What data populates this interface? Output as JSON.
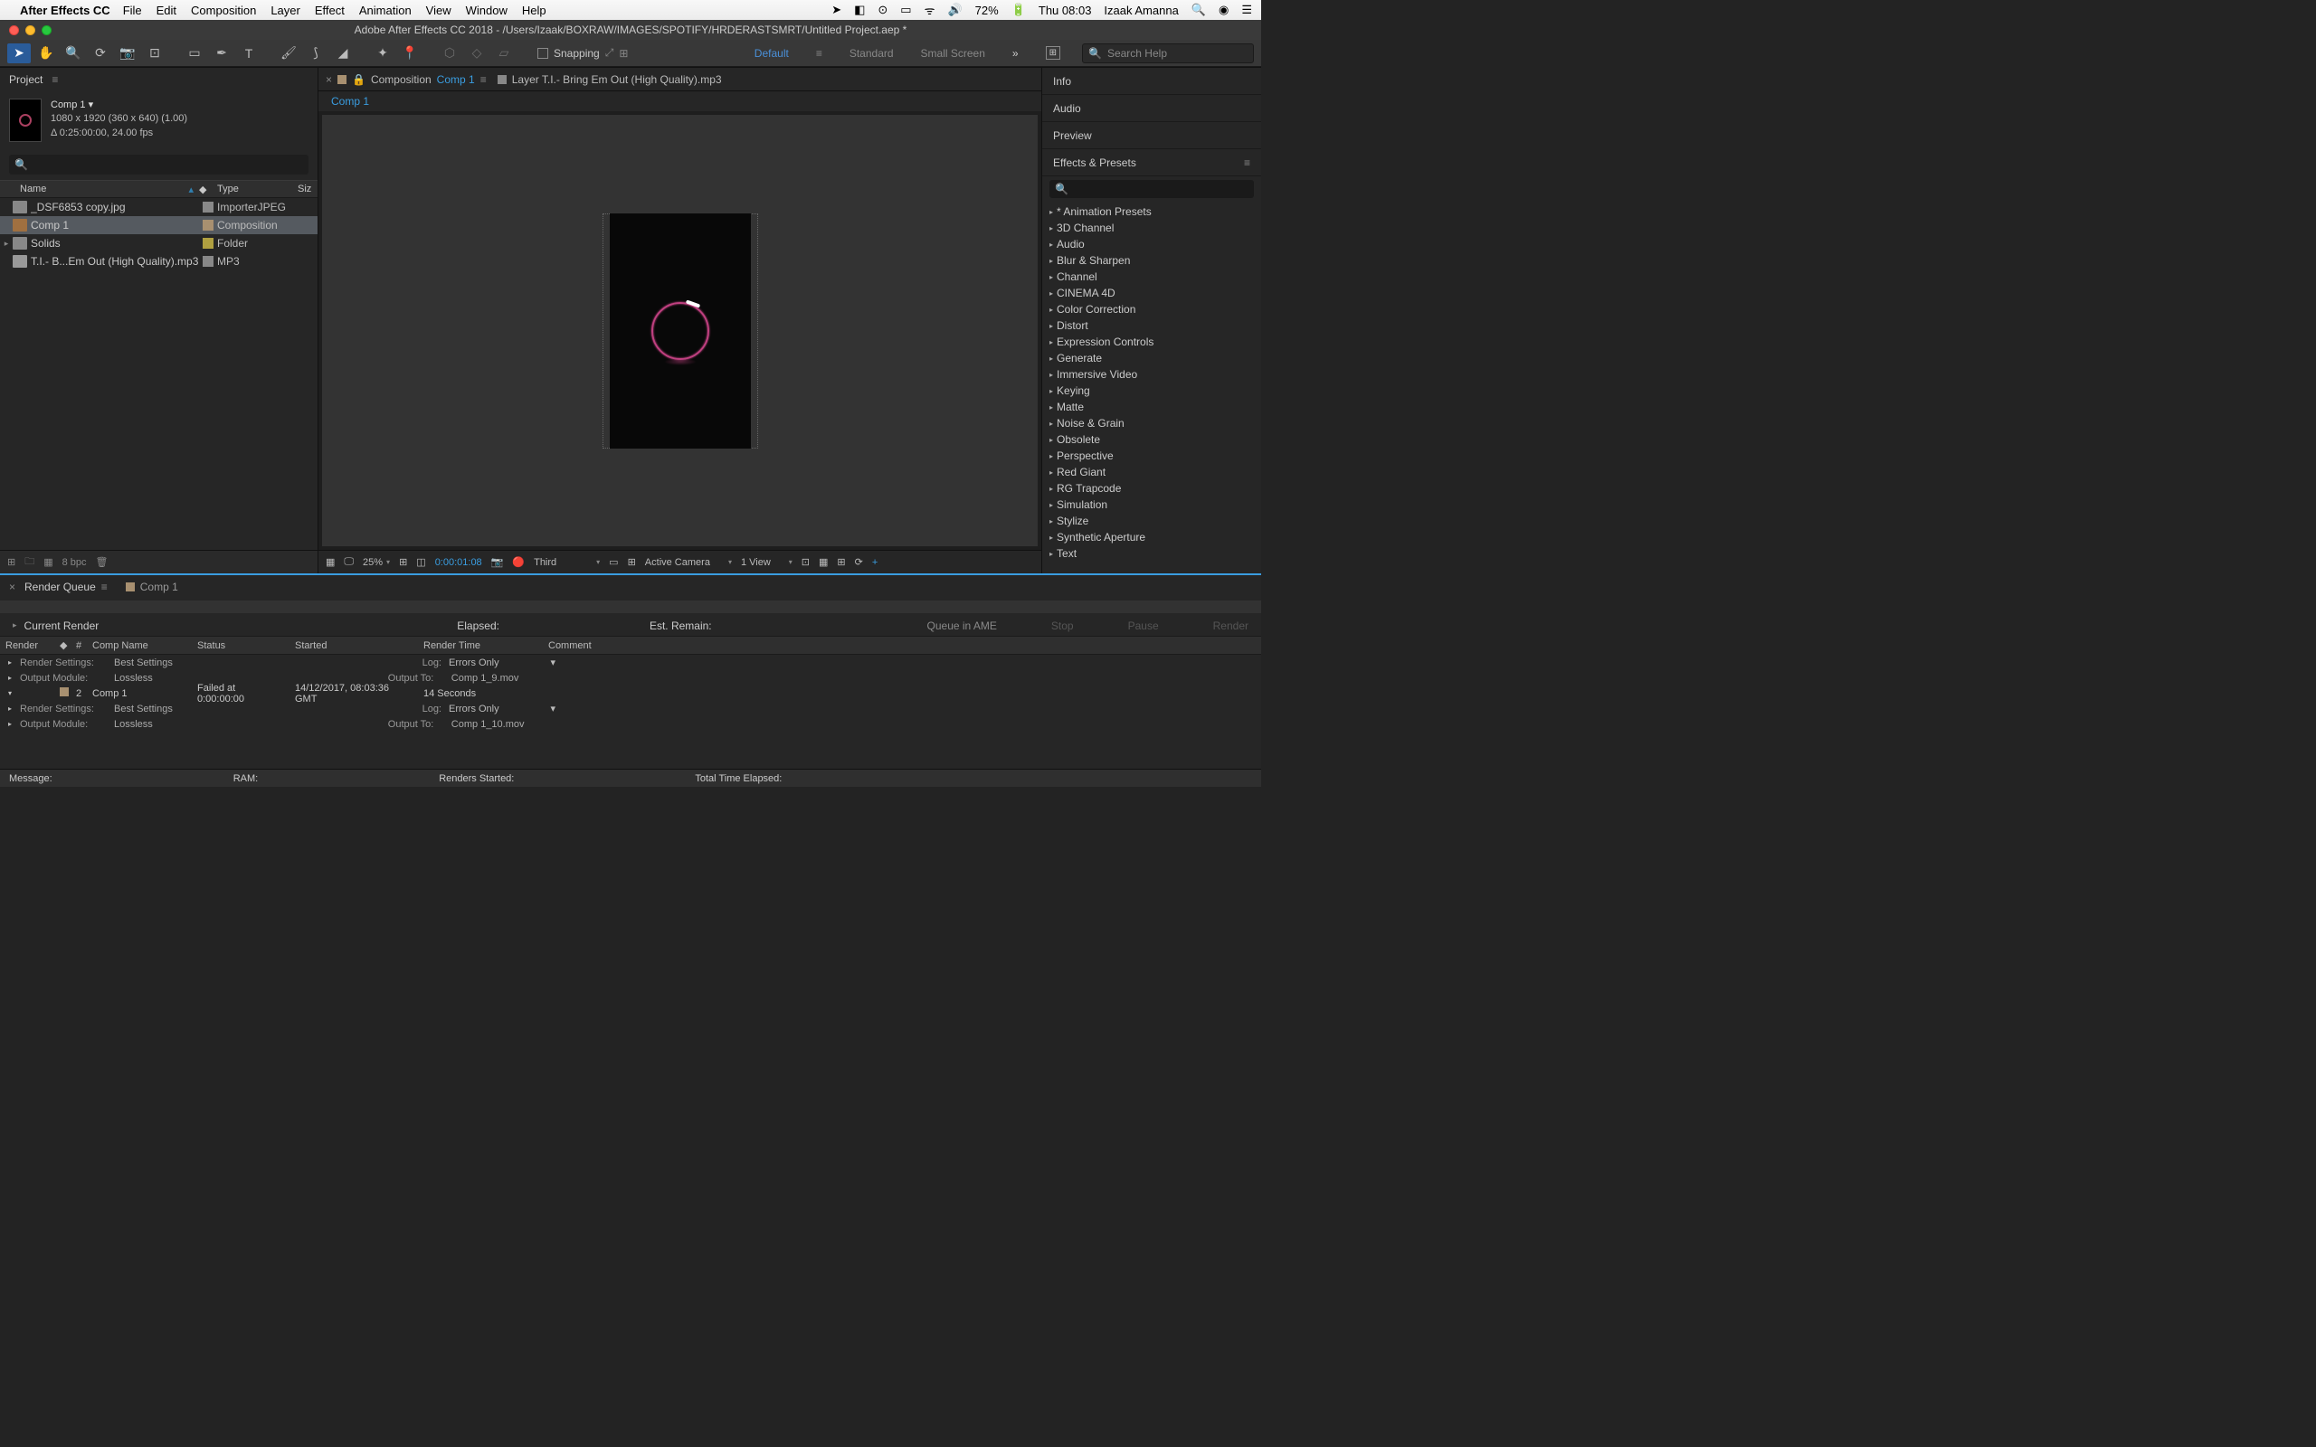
{
  "mac": {
    "app_name": "After Effects CC",
    "menus": [
      "File",
      "Edit",
      "Composition",
      "Layer",
      "Effect",
      "Animation",
      "View",
      "Window",
      "Help"
    ],
    "battery": "72%",
    "clock": "Thu 08:03",
    "user": "Izaak Amanna"
  },
  "window": {
    "title": "Adobe After Effects CC 2018 - /Users/Izaak/BOXRAW/IMAGES/SPOTIFY/HRDERASTSMRT/Untitled Project.aep *"
  },
  "toolbar": {
    "snapping": "Snapping",
    "workspaces": {
      "default": "Default",
      "standard": "Standard",
      "small": "Small Screen"
    },
    "search_placeholder": "Search Help"
  },
  "project": {
    "panel_title": "Project",
    "comp": {
      "name": "Comp 1 ▾",
      "dims": "1080 x 1920  (360 x 640) (1.00)",
      "dur": "Δ 0:25:00:00, 24.00 fps"
    },
    "cols": {
      "name": "Name",
      "type": "Type",
      "size": "Siz"
    },
    "items": [
      {
        "name": "_DSF6853 copy.jpg",
        "type": "ImporterJPEG",
        "label": "gray",
        "icon": "img",
        "twisty": ""
      },
      {
        "name": "Comp 1",
        "type": "Composition",
        "label": "tan",
        "icon": "comp",
        "twisty": "",
        "selected": true
      },
      {
        "name": "Solids",
        "type": "Folder",
        "label": "yellow",
        "icon": "folder",
        "twisty": "▸"
      },
      {
        "name": "T.I.- B...Em Out (High Quality).mp3",
        "type": "MP3",
        "label": "gray",
        "icon": "mp3",
        "twisty": ""
      }
    ],
    "footer_bpc": "8 bpc"
  },
  "comp_viewer": {
    "tab1_prefix": "Composition",
    "tab1_name": "Comp 1",
    "tab2": "Layer T.I.- Bring Em Out (High Quality).mp3",
    "flow": "Comp 1",
    "footer": {
      "zoom": "25%",
      "time": "0:00:01:08",
      "res": "Third",
      "camera": "Active Camera",
      "views": "1 View"
    }
  },
  "panels": {
    "info": "Info",
    "audio": "Audio",
    "preview": "Preview",
    "fx_title": "Effects & Presets",
    "fx_items": [
      "* Animation Presets",
      "3D Channel",
      "Audio",
      "Blur & Sharpen",
      "Channel",
      "CINEMA 4D",
      "Color Correction",
      "Distort",
      "Expression Controls",
      "Generate",
      "Immersive Video",
      "Keying",
      "Matte",
      "Noise & Grain",
      "Obsolete",
      "Perspective",
      "Red Giant",
      "RG Trapcode",
      "Simulation",
      "Stylize",
      "Synthetic Aperture",
      "Text"
    ]
  },
  "rq": {
    "tab1": "Render Queue",
    "tab2": "Comp 1",
    "current": "Current Render",
    "elapsed": "Elapsed:",
    "remain": "Est. Remain:",
    "actions": {
      "ame": "Queue in AME",
      "stop": "Stop",
      "pause": "Pause",
      "render": "Render"
    },
    "cols": {
      "render": "Render",
      "num": "#",
      "comp": "Comp Name",
      "status": "Status",
      "started": "Started",
      "time": "Render Time",
      "comment": "Comment"
    },
    "line_rs": "Render Settings:",
    "line_rs_val": "Best Settings",
    "line_om": "Output Module:",
    "line_om_val": "Lossless",
    "log": "Log:",
    "log_val": "Errors Only",
    "outto": "Output To:",
    "out1": "Comp 1_9.mov",
    "row2": {
      "num": "2",
      "name": "Comp 1",
      "status": "Failed at 0:00:00:00",
      "started": "14/12/2017, 08:03:36 GMT",
      "time": "14 Seconds"
    },
    "out2": "Comp 1_10.mov",
    "footer": {
      "msg": "Message:",
      "ram": "RAM:",
      "started": "Renders Started:",
      "total": "Total Time Elapsed:"
    }
  }
}
